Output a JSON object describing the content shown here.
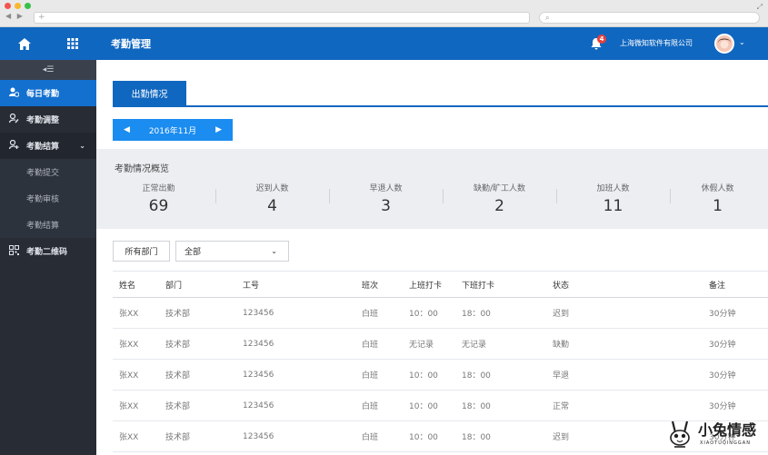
{
  "browser": {
    "nav_arrows": "◀ ▶",
    "new_tab": "+",
    "search_icon": "⌕",
    "expand_icon": "⤢"
  },
  "topbar": {
    "title": "考勤管理",
    "notification_count": "4",
    "company": "上海微知软件有限公司",
    "bg_color": "#1067c0"
  },
  "sidebar": {
    "collapse_icon": "◂☰",
    "items": [
      {
        "label": "每日考勤",
        "icon": "user-clock-icon",
        "active": true
      },
      {
        "label": "考勤调整",
        "icon": "user-edit-icon",
        "active": false
      },
      {
        "label": "考勤结算",
        "icon": "user-add-icon",
        "active": false,
        "expanded": true,
        "children": [
          {
            "label": "考勤提交"
          },
          {
            "label": "考勤审核"
          },
          {
            "label": "考勤结算"
          }
        ]
      },
      {
        "label": "考勤二维码",
        "icon": "qrcode-icon",
        "active": false
      }
    ]
  },
  "main": {
    "tab_label": "出勤情况",
    "month": "2016年11月",
    "summary": {
      "title": "考勤情况概览",
      "stats": [
        {
          "label": "正常出勤",
          "value": "69"
        },
        {
          "label": "迟到人数",
          "value": "4"
        },
        {
          "label": "早退人数",
          "value": "3"
        },
        {
          "label": "缺勤/旷工人数",
          "value": "2"
        },
        {
          "label": "加班人数",
          "value": "11"
        },
        {
          "label": "休假人数",
          "value": "1"
        }
      ]
    },
    "filter": {
      "dept_button": "所有部门",
      "select_value": "全部"
    },
    "table": {
      "headers": [
        "姓名",
        "部门",
        "工号",
        "班次",
        "上班打卡",
        "下班打卡",
        "状态",
        "备注"
      ],
      "rows": [
        [
          "张XX",
          "技术部",
          "123456",
          "白班",
          "10：00",
          "18：00",
          "迟到",
          "30分钟"
        ],
        [
          "张XX",
          "技术部",
          "123456",
          "白班",
          "无记录",
          "无记录",
          "缺勤",
          "30分钟"
        ],
        [
          "张XX",
          "技术部",
          "123456",
          "白班",
          "10：00",
          "18：00",
          "早退",
          "30分钟"
        ],
        [
          "张XX",
          "技术部",
          "123456",
          "白班",
          "10：00",
          "18：00",
          "正常",
          "30分钟"
        ],
        [
          "张XX",
          "技术部",
          "123456",
          "白班",
          "10：00",
          "18：00",
          "迟到",
          "30分钟"
        ]
      ]
    }
  },
  "watermark": {
    "title": "小兔情感",
    "subtitle": "XIAOTUQINGGAN"
  }
}
